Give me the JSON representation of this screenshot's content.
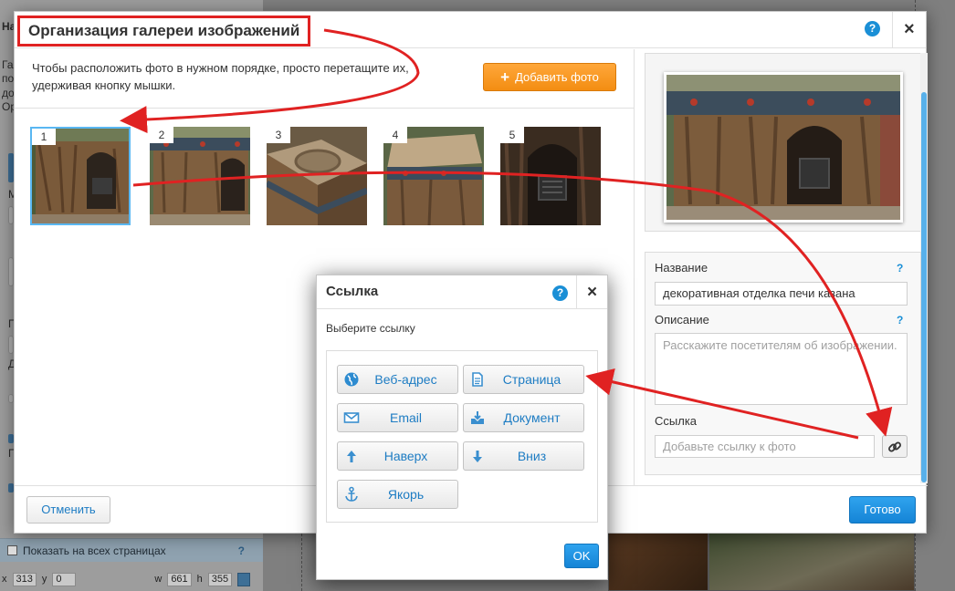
{
  "background": {
    "left_fragments": [
      "На",
      "Га",
      "по",
      "до",
      "Ор",
      "М",
      "П",
      "Д",
      "П"
    ],
    "show_all_pages_label": "Показать на всех страницах",
    "help_mark": "?",
    "coords": {
      "x_label": "x",
      "x": "313",
      "y_label": "y",
      "y": "0",
      "w_label": "w",
      "w": "661",
      "h_label": "h",
      "h": "355"
    }
  },
  "gallery_dialog": {
    "title": "Организация галереи изображений",
    "help": "?",
    "close": "×",
    "instruction": "Чтобы расположить фото в нужном порядке, просто перетащите их, удерживая кнопку мышки.",
    "add_photo": "Добавить фото",
    "thumbnails": [
      {
        "number": "1",
        "selected": true
      },
      {
        "number": "2",
        "selected": false
      },
      {
        "number": "3",
        "selected": false
      },
      {
        "number": "4",
        "selected": false
      },
      {
        "number": "5",
        "selected": false
      }
    ],
    "name_label": "Название",
    "name_value": "декоративная отделка печи казана",
    "description_label": "Описание",
    "description_placeholder": "Расскажите посетителям об изображении.",
    "link_label": "Ссылка",
    "link_placeholder": "Добавьте ссылку к фото",
    "field_help": "?",
    "cancel": "Отменить",
    "done": "Готово"
  },
  "link_dialog": {
    "title": "Ссылка",
    "help": "?",
    "close": "×",
    "subtitle": "Выберите ссылку",
    "buttons": [
      {
        "label": "Веб-адрес",
        "icon": "globe-icon"
      },
      {
        "label": "Страница",
        "icon": "page-icon"
      },
      {
        "label": "Email",
        "icon": "envelope-icon"
      },
      {
        "label": "Документ",
        "icon": "download-document-icon"
      },
      {
        "label": "Наверх",
        "icon": "arrow-up-icon"
      },
      {
        "label": "Вниз",
        "icon": "arrow-down-icon"
      },
      {
        "label": "Якорь",
        "icon": "anchor-icon"
      }
    ],
    "ok": "OK"
  },
  "colors": {
    "annotation_red": "#e02222",
    "primary_blue": "#1584d6",
    "add_orange": "#f38d12",
    "link_text_blue": "#1d7cc3"
  }
}
